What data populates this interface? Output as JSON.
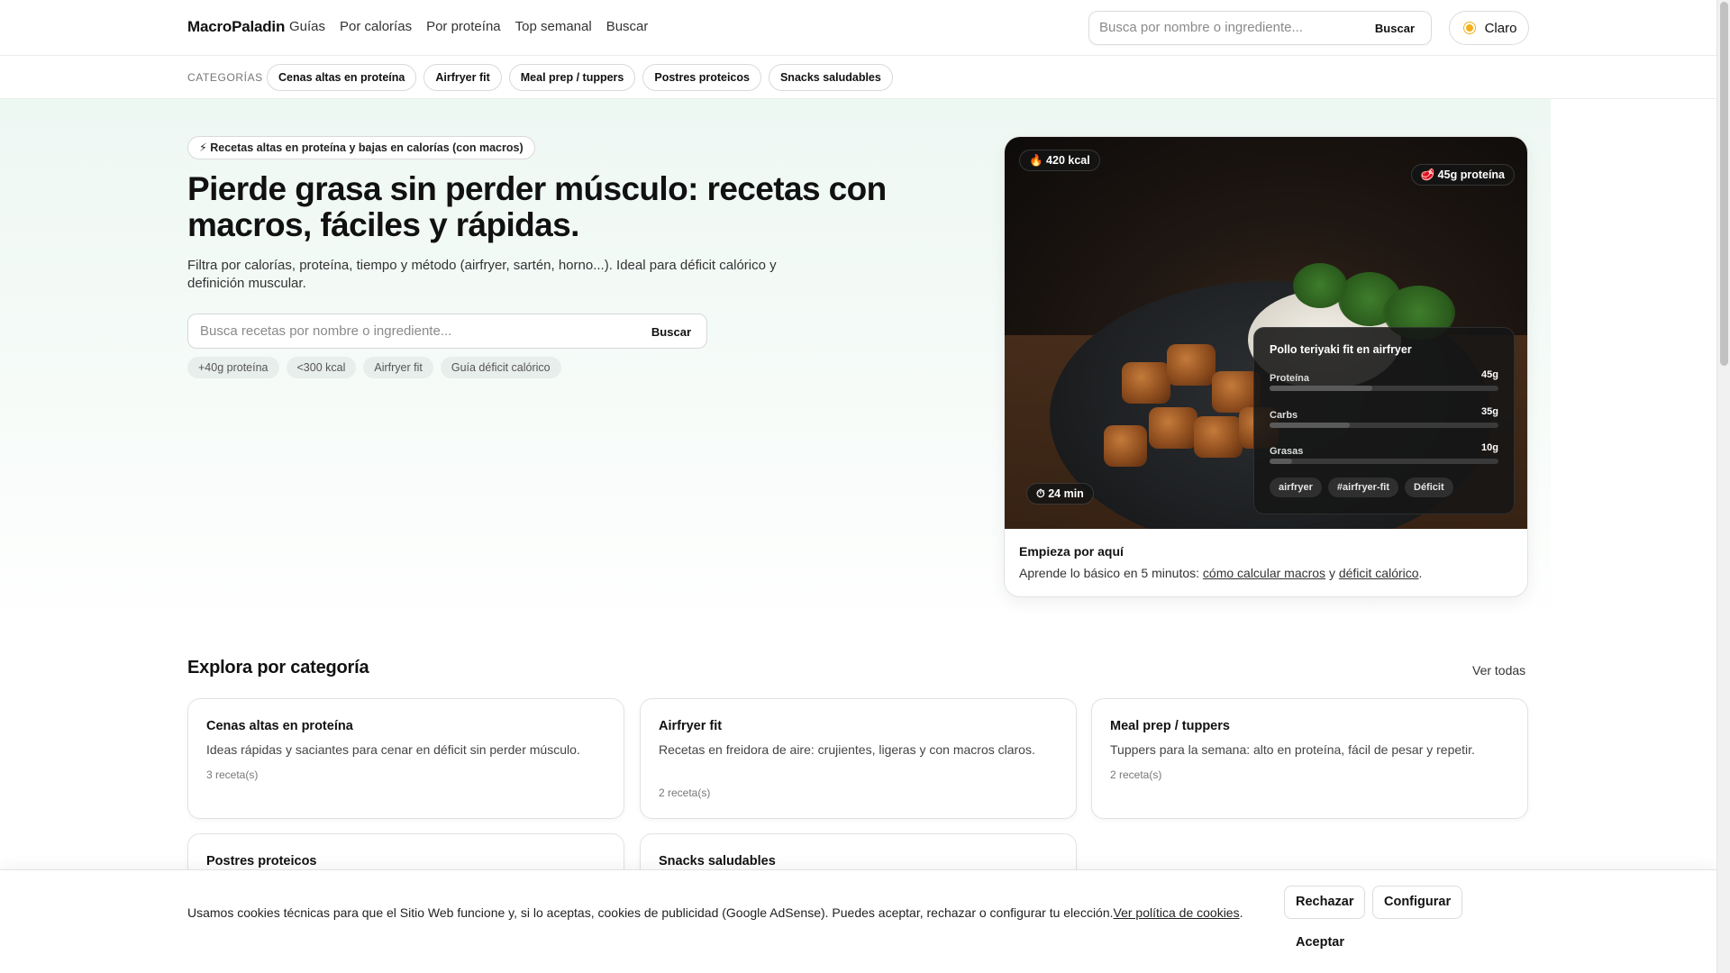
{
  "header": {
    "brand": "MacroPaladin",
    "nav": [
      "Guías",
      "Por calorías",
      "Por proteína",
      "Top semanal",
      "Buscar"
    ],
    "search_placeholder": "Busca por nombre o ingrediente...",
    "search_button": "Buscar",
    "theme_label": "Claro",
    "theme_icon": "sun-icon"
  },
  "categories_bar": {
    "label": "CATEGORÍAS",
    "chips": [
      "Cenas altas en proteína",
      "Airfryer fit",
      "Meal prep / tuppers",
      "Postres proteicos",
      "Snacks saludables"
    ]
  },
  "hero": {
    "badge": "⚡ Recetas altas en proteína y bajas en calorías (con macros)",
    "headline": "Pierde grasa sin perder músculo: recetas con macros, fáciles y rápidas.",
    "subtitle": "Filtra por calorías, proteína, tiempo y método (airfryer, sartén, horno...). Ideal para déficit calórico y definición muscular.",
    "search_placeholder": "Busca recetas por nombre o ingrediente...",
    "search_button": "Buscar",
    "quick_filters": [
      "+40g proteína",
      "<300 kcal",
      "Airfryer fit",
      "Guía déficit calórico"
    ]
  },
  "feature_card": {
    "kcal": "🔥 420 kcal",
    "protein_badge": "🥩 45g proteína",
    "time": "⏱ 24 min",
    "recipe_title": "Pollo teriyaki fit en airfryer",
    "macros": [
      {
        "name": "Proteína",
        "value": "45g",
        "fill": 0.45
      },
      {
        "name": "Carbs",
        "value": "35g",
        "fill": 0.35
      },
      {
        "name": "Grasas",
        "value": "10g",
        "fill": 0.1
      }
    ],
    "tags": [
      "airfryer",
      "#airfryer-fit",
      "Déficit"
    ],
    "start_title": "Empieza por aquí",
    "start_text_prefix": "Aprende lo básico en 5 minutos: ",
    "start_link_1": "cómo calcular macros",
    "start_text_mid": " y ",
    "start_link_2": "déficit calórico",
    "start_text_suffix": "."
  },
  "explore": {
    "title": "Explora por categoría",
    "see_all": "Ver todas",
    "cards": [
      {
        "title": "Cenas altas en proteína",
        "desc": "Ideas rápidas y saciantes para cenar en déficit sin perder músculo.",
        "count": "3 receta(s)"
      },
      {
        "title": "Airfryer fit",
        "desc": "Recetas en freidora de aire: crujientes, ligeras y con macros claros.",
        "count": "2 receta(s)"
      },
      {
        "title": "Meal prep / tuppers",
        "desc": "Tuppers para la semana: alto en proteína, fácil de pesar y repetir.",
        "count": "2 receta(s)"
      },
      {
        "title": "Postres proteicos",
        "desc": "",
        "count": ""
      },
      {
        "title": "Snacks saludables",
        "desc": "",
        "count": ""
      }
    ]
  },
  "cookie": {
    "text": "Usamos cookies técnicas para que el Sitio Web funcione y, si lo aceptas, cookies de publicidad (Google AdSense). Puedes aceptar, rechazar o configurar tu elección.",
    "link": "Ver política de cookies",
    "suffix": ".",
    "reject": "Rechazar",
    "configure": "Configurar",
    "accept": "Aceptar"
  }
}
